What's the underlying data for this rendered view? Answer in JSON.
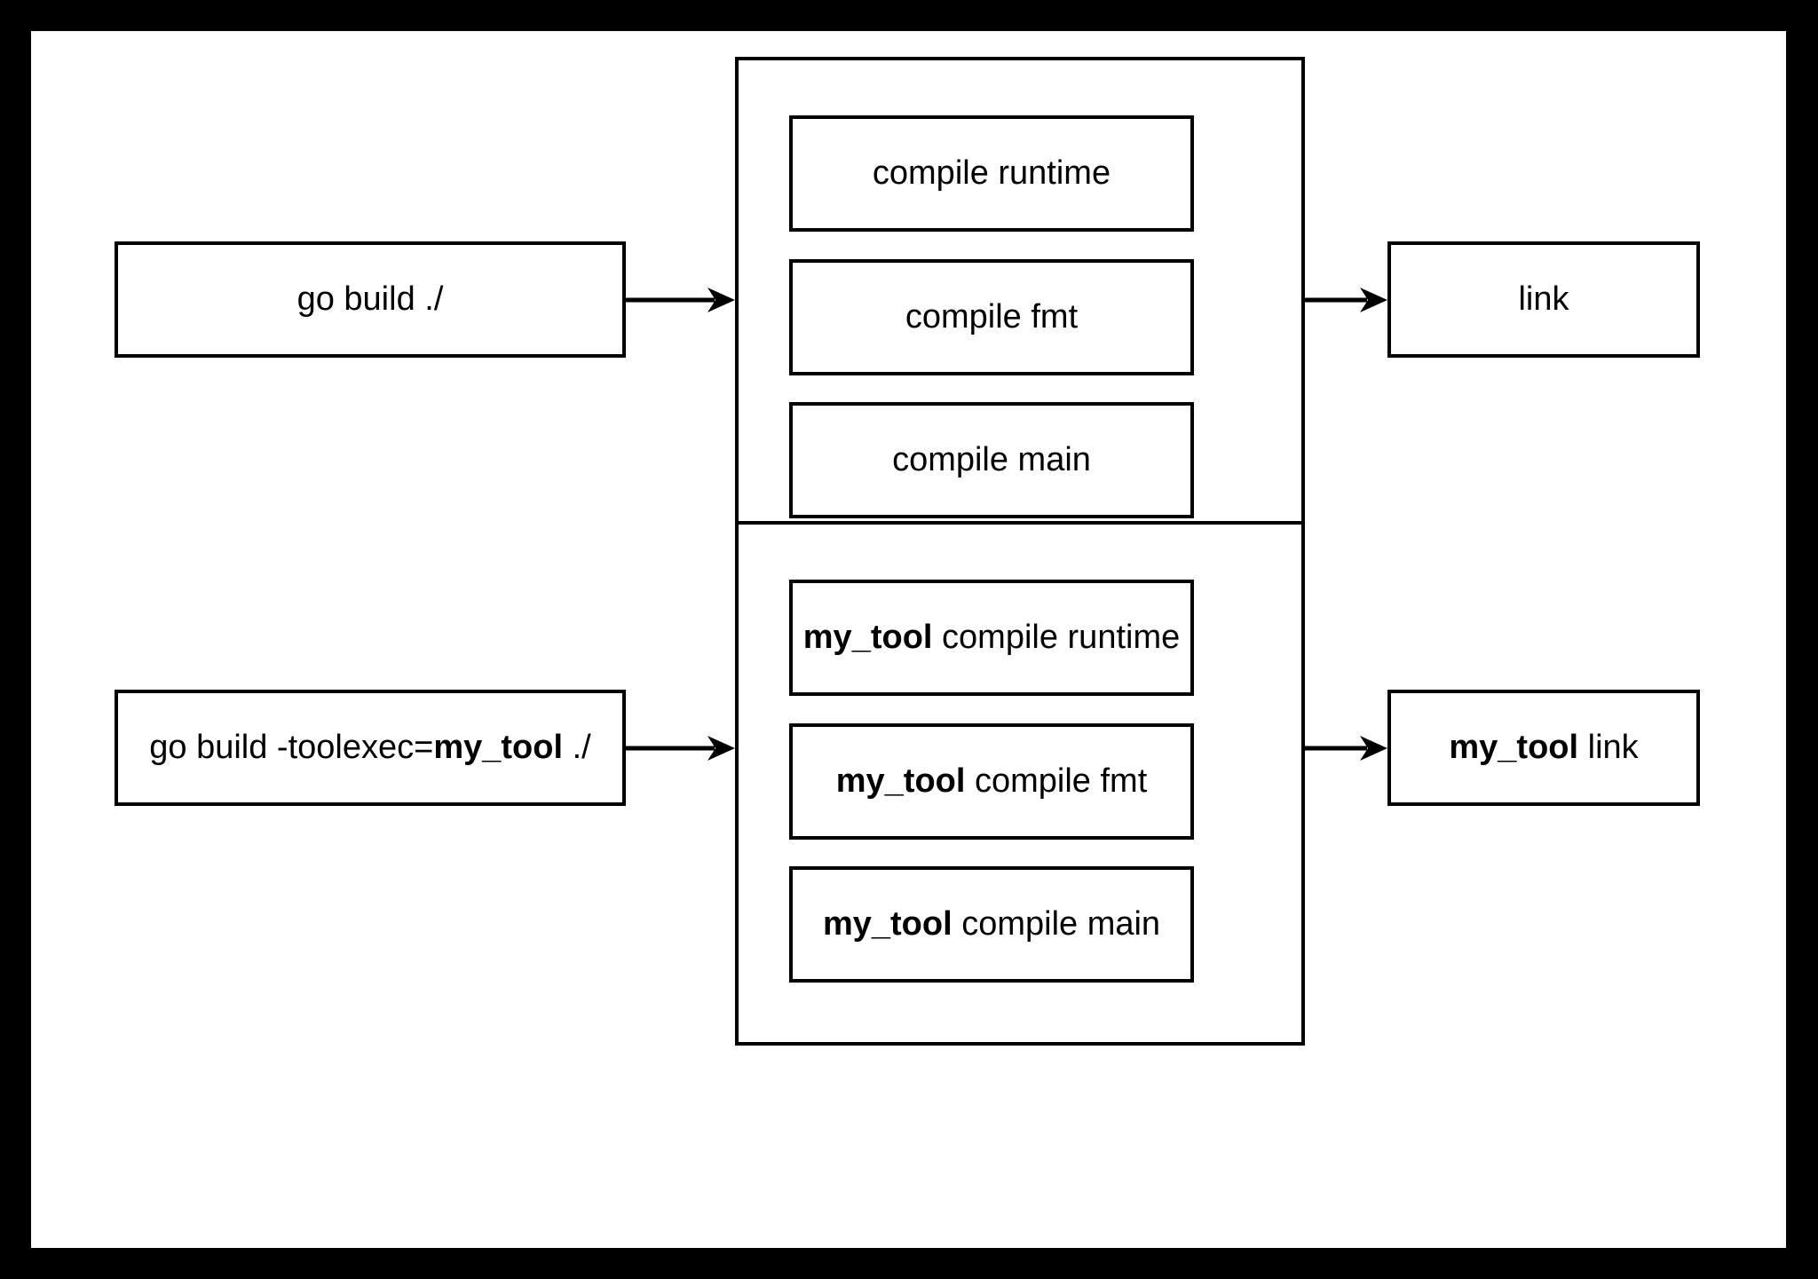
{
  "diagram": {
    "frame_color": "#000000",
    "surface_color": "#ffffff",
    "stroke_color": "#000000",
    "rows": [
      {
        "id": "plain-build",
        "command_box": {
          "text": "go build ./",
          "bold_part": ""
        },
        "group_label": "",
        "steps": [
          {
            "prefix": "",
            "text": "compile runtime"
          },
          {
            "prefix": "",
            "text": "compile fmt"
          },
          {
            "prefix": "",
            "text": "compile main"
          }
        ],
        "output_box": {
          "prefix": "",
          "text": "link"
        }
      },
      {
        "id": "toolexec-build",
        "command_box": {
          "pre": "go build -toolexec=",
          "bold_part": "my_tool",
          "post": " ./"
        },
        "group_label": "",
        "steps": [
          {
            "prefix": "my_tool",
            "text": " compile runtime"
          },
          {
            "prefix": "my_tool",
            "text": " compile fmt"
          },
          {
            "prefix": "my_tool",
            "text": " compile main"
          }
        ],
        "output_box": {
          "prefix": "my_tool",
          "text": " link"
        }
      }
    ],
    "arrows": {
      "count": 4,
      "style": "solid-filled-triangle-head",
      "direction": "left-to-right"
    }
  }
}
